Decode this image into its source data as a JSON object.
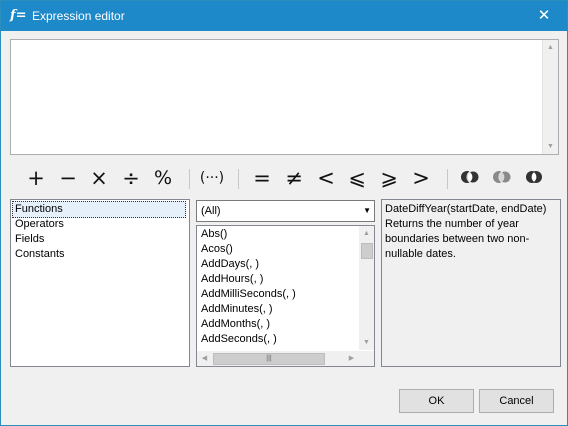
{
  "window": {
    "title": "Expression editor",
    "icon": "f=",
    "close_glyph": "✕"
  },
  "operators": {
    "arithmetic": [
      "+",
      "−",
      "×",
      "÷",
      "%"
    ],
    "group": "(···)",
    "comparison": [
      "=",
      "≠",
      "<",
      "⩽",
      "⩾",
      ">"
    ],
    "logic_icons": [
      "and-icon",
      "or-icon",
      "not-icon"
    ]
  },
  "categories": {
    "items": [
      "Functions",
      "Operators",
      "Fields",
      "Constants"
    ],
    "selected": "Functions"
  },
  "filter": {
    "value": "(All)"
  },
  "functions": {
    "items": [
      "Abs()",
      "Acos()",
      "AddDays(, )",
      "AddHours(, )",
      "AddMilliSeconds(, )",
      "AddMinutes(, )",
      "AddMonths(, )",
      "AddSeconds(, )"
    ]
  },
  "description": {
    "signature": "DateDiffYear(startDate, endDate)",
    "text": "Returns the number of year boundaries between two non-nullable dates."
  },
  "buttons": {
    "ok": "OK",
    "cancel": "Cancel"
  }
}
